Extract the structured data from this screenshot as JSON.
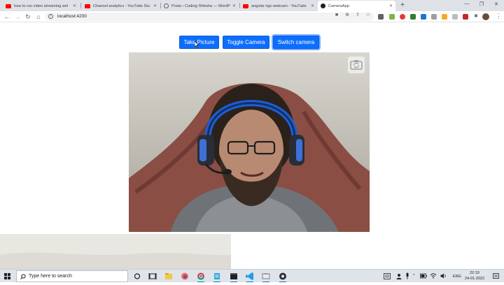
{
  "browser": {
    "tabs": [
      {
        "title": "how to run video streaming wel",
        "favicon": "youtube-icon",
        "active": false
      },
      {
        "title": "Channel analytics - YouTube Stu",
        "favicon": "youtube-icon",
        "active": false
      },
      {
        "title": "Posts ‹ Coding Shiksha — WordP",
        "favicon": "globe-icon",
        "active": false
      },
      {
        "title": "angular ngx-webcam - YouTube",
        "favicon": "youtube-icon",
        "active": false
      },
      {
        "title": "CameraApp",
        "favicon": "angular-icon",
        "active": true
      }
    ],
    "url": "localhost:4200"
  },
  "app": {
    "buttons": {
      "take_picture": "Take Picture",
      "toggle_camera": "Toggle Camera",
      "switch_camera": "Switch camera"
    }
  },
  "taskbar": {
    "search_placeholder": "Type here to search",
    "language": "ENG",
    "time": "22:19",
    "date": "24-01-2022"
  },
  "colors": {
    "primary_button": "#0d6efd",
    "chrome_tabstrip": "#dee1e6",
    "taskbar": "#dfe3ea"
  }
}
